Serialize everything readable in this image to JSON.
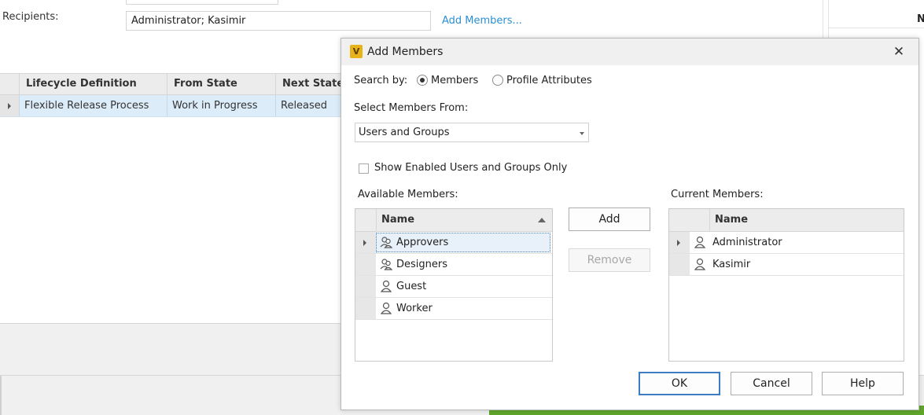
{
  "background": {
    "recipients_label": "Recipients:",
    "recipients_value": "Administrator; Kasimir",
    "add_members_link": "Add Members...",
    "right_header": "N",
    "grid": {
      "columns": [
        "Lifecycle Definition",
        "From State",
        "Next State"
      ],
      "rows": [
        [
          "Flexible Release Process",
          "Work in Progress",
          "Released"
        ]
      ]
    }
  },
  "dialog": {
    "title": "Add Members",
    "app_icon_letter": "V",
    "search_by_label": "Search by:",
    "search_options": [
      "Members",
      "Profile Attributes"
    ],
    "selected_search_option": "Members",
    "select_from_label": "Select Members From:",
    "select_from_value": "Users and Groups",
    "show_enabled_label": "Show Enabled Users and Groups Only",
    "show_enabled_checked": false,
    "available": {
      "label": "Available Members:",
      "column": "Name",
      "items": [
        {
          "name": "Approvers",
          "icon": "group-icon",
          "expandable": true,
          "selected": true
        },
        {
          "name": "Designers",
          "icon": "group-icon",
          "expandable": false,
          "selected": false
        },
        {
          "name": "Guest",
          "icon": "user-icon",
          "expandable": false,
          "selected": false
        },
        {
          "name": "Worker",
          "icon": "user-icon",
          "expandable": false,
          "selected": false
        }
      ]
    },
    "current": {
      "label": "Current Members:",
      "column": "Name",
      "items": [
        {
          "name": "Administrator",
          "icon": "user-icon",
          "expandable": true
        },
        {
          "name": "Kasimir",
          "icon": "user-icon",
          "expandable": false
        }
      ]
    },
    "buttons": {
      "add": "Add",
      "remove": "Remove",
      "ok": "OK",
      "cancel": "Cancel",
      "help": "Help"
    }
  }
}
